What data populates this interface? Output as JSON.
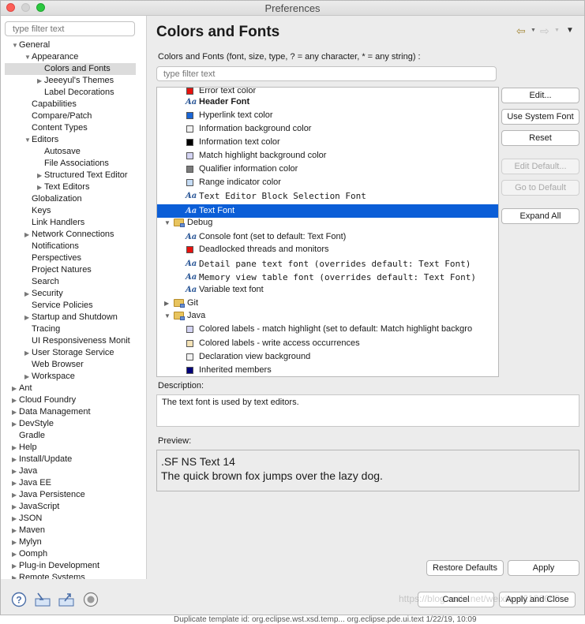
{
  "window": {
    "title": "Preferences"
  },
  "sidebar": {
    "filter_placeholder": "type filter text",
    "items": [
      {
        "label": "General",
        "expanded": true
      },
      {
        "label": "Appearance",
        "expanded": true
      },
      {
        "label": "Colors and Fonts",
        "selected": true
      },
      {
        "label": "Jeeeyul's Themes",
        "expanded": false
      },
      {
        "label": "Label Decorations"
      },
      {
        "label": "Capabilities"
      },
      {
        "label": "Compare/Patch"
      },
      {
        "label": "Content Types"
      },
      {
        "label": "Editors",
        "expanded": true
      },
      {
        "label": "Autosave"
      },
      {
        "label": "File Associations"
      },
      {
        "label": "Structured Text Editor",
        "expanded": false
      },
      {
        "label": "Text Editors",
        "expanded": false
      },
      {
        "label": "Globalization"
      },
      {
        "label": "Keys"
      },
      {
        "label": "Link Handlers"
      },
      {
        "label": "Network Connections",
        "expanded": false
      },
      {
        "label": "Notifications"
      },
      {
        "label": "Perspectives"
      },
      {
        "label": "Project Natures"
      },
      {
        "label": "Search"
      },
      {
        "label": "Security",
        "expanded": false
      },
      {
        "label": "Service Policies"
      },
      {
        "label": "Startup and Shutdown",
        "expanded": false
      },
      {
        "label": "Tracing"
      },
      {
        "label": "UI Responsiveness Monit"
      },
      {
        "label": "User Storage Service",
        "expanded": false
      },
      {
        "label": "Web Browser"
      },
      {
        "label": "Workspace",
        "expanded": false
      },
      {
        "label": "Ant",
        "expanded": false
      },
      {
        "label": "Cloud Foundry",
        "expanded": false
      },
      {
        "label": "Data Management",
        "expanded": false
      },
      {
        "label": "DevStyle",
        "expanded": false
      },
      {
        "label": "Gradle"
      },
      {
        "label": "Help",
        "expanded": false
      },
      {
        "label": "Install/Update",
        "expanded": false
      },
      {
        "label": "Java",
        "expanded": false
      },
      {
        "label": "Java EE",
        "expanded": false
      },
      {
        "label": "Java Persistence",
        "expanded": false
      },
      {
        "label": "JavaScript",
        "expanded": false
      },
      {
        "label": "JSON",
        "expanded": false
      },
      {
        "label": "Maven",
        "expanded": false
      },
      {
        "label": "Mylyn",
        "expanded": false
      },
      {
        "label": "Oomph",
        "expanded": false
      },
      {
        "label": "Plug-in Development",
        "expanded": false
      },
      {
        "label": "Remote Systems",
        "expanded": false
      }
    ]
  },
  "page": {
    "title": "Colors and Fonts",
    "intro": "Colors and Fonts (font, size, type, ? = any character, * = any string) :",
    "filter_placeholder": "type filter text"
  },
  "list": {
    "rows": [
      {
        "kind": "color",
        "label": "Error text color",
        "color": "#e8120e"
      },
      {
        "kind": "font",
        "label": "Header Font"
      },
      {
        "kind": "color",
        "label": "Hyperlink text color",
        "color": "#1a66d6"
      },
      {
        "kind": "color",
        "label": "Information background color",
        "color": "#f2f2f2"
      },
      {
        "kind": "color",
        "label": "Information text color",
        "color": "#000000"
      },
      {
        "kind": "color",
        "label": "Match highlight background color",
        "color": "#d4d4f4"
      },
      {
        "kind": "color",
        "label": "Qualifier information color",
        "color": "#7a7a7a"
      },
      {
        "kind": "color",
        "label": "Range indicator color",
        "color": "#c5dcf5"
      },
      {
        "kind": "font",
        "label": "Text Editor Block Selection Font"
      },
      {
        "kind": "font",
        "label": "Text Font",
        "selected": true
      },
      {
        "kind": "category",
        "label": "Debug",
        "expanded": true
      },
      {
        "kind": "font",
        "label": "Console font (set to default: Text Font)"
      },
      {
        "kind": "color",
        "label": "Deadlocked threads and monitors",
        "color": "#e8120e"
      },
      {
        "kind": "font",
        "label": "Detail pane text font (overrides default: Text Font)"
      },
      {
        "kind": "font",
        "label": "Memory view table font (overrides default: Text Font)"
      },
      {
        "kind": "font",
        "label": "Variable text font"
      },
      {
        "kind": "category",
        "label": "Git",
        "expanded": false
      },
      {
        "kind": "category",
        "label": "Java",
        "expanded": true
      },
      {
        "kind": "color",
        "label": "Colored labels - match highlight (set to default: Match highlight backgro",
        "color": "#d4d4f4"
      },
      {
        "kind": "color",
        "label": "Colored labels - write access occurrences",
        "color": "#f4e2b6"
      },
      {
        "kind": "color",
        "label": "Declaration view background",
        "color": "#f2f2f2"
      },
      {
        "kind": "color",
        "label": "Inherited members",
        "color": "#00007a"
      }
    ]
  },
  "buttons": {
    "edit": "Edit...",
    "use_system_font": "Use System Font",
    "reset": "Reset",
    "edit_default": "Edit Default...",
    "go_to_default": "Go to Default",
    "expand_all": "Expand All",
    "restore_defaults": "Restore Defaults",
    "apply": "Apply",
    "cancel": "Cancel",
    "apply_and_close": "Apply and Close"
  },
  "description": {
    "label": "Description:",
    "text": "The text font is used by text editors."
  },
  "preview": {
    "label": "Preview:",
    "line1": ".SF NS Text 14",
    "line2": "The quick brown fox jumps over the lazy dog."
  },
  "footer_icons": [
    "help-icon",
    "import-icon",
    "export-icon",
    "record-icon"
  ],
  "watermark": "https://blog.csdn.net/weixin_42106600",
  "background_text": "Duplicate template id: org.eclipse.wst.xsd.temp... org.eclipse.pde.ui.text   1/22/19, 10:09"
}
